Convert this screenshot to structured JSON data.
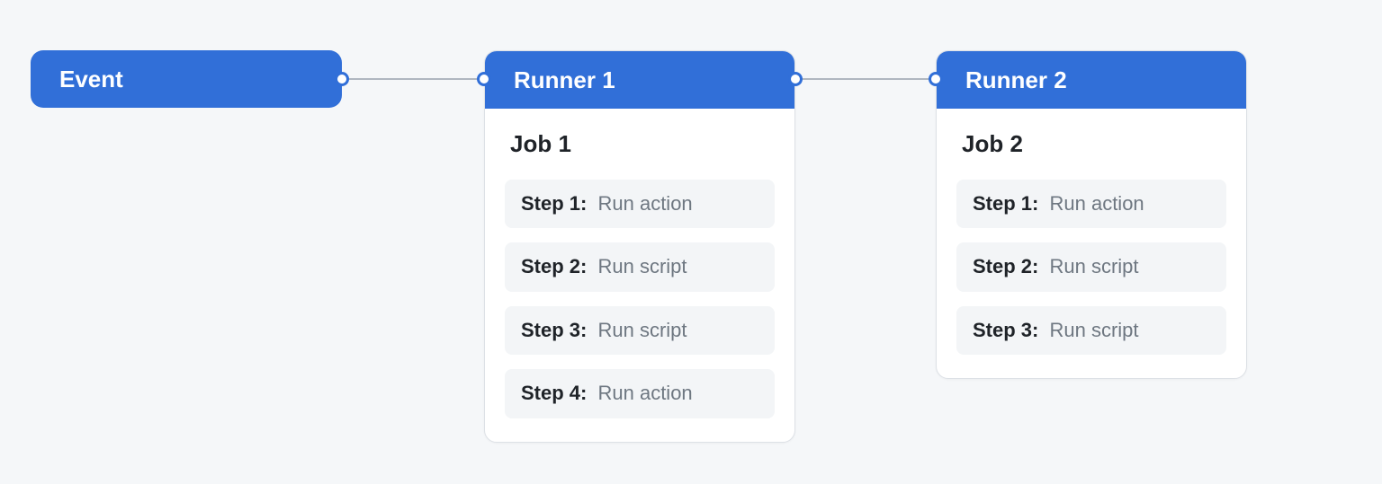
{
  "colors": {
    "accent": "#316fd8"
  },
  "event": {
    "label": "Event"
  },
  "runners": [
    {
      "header": "Runner 1",
      "job_title": "Job 1",
      "steps": [
        {
          "label": "Step 1:",
          "desc": "Run action"
        },
        {
          "label": "Step 2:",
          "desc": "Run script"
        },
        {
          "label": "Step 3:",
          "desc": "Run script"
        },
        {
          "label": "Step 4:",
          "desc": "Run action"
        }
      ]
    },
    {
      "header": "Runner 2",
      "job_title": "Job 2",
      "steps": [
        {
          "label": "Step 1:",
          "desc": "Run action"
        },
        {
          "label": "Step 2:",
          "desc": "Run script"
        },
        {
          "label": "Step 3:",
          "desc": "Run script"
        }
      ]
    }
  ]
}
